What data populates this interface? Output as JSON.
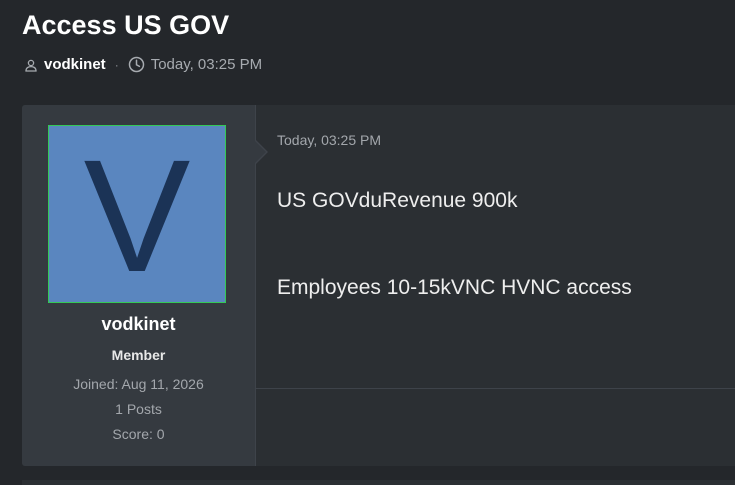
{
  "thread": {
    "title": "Access US GOV",
    "author": "vodkinet",
    "separator": "·",
    "time": "Today, 03:25 PM"
  },
  "icons": {
    "author": "user-icon",
    "time": "clock-icon"
  },
  "post": {
    "date": "Today, 03:25 PM",
    "lines": [
      "US GOVduRevenue 900k",
      "Employees 10-15kVNC HVNC access"
    ]
  },
  "user": {
    "avatar_letter": "V",
    "name": "vodkinet",
    "role": "Member",
    "joined": "Joined: Aug 11, 2026",
    "posts": "1 Posts",
    "score": "Score: 0"
  },
  "colors": {
    "background": "#24272b",
    "post_background": "#2b2f33",
    "user_cell": "#353a40",
    "avatar_bg": "#5a86bf",
    "avatar_letter": "#1b3356",
    "avatar_border": "#34c957"
  }
}
